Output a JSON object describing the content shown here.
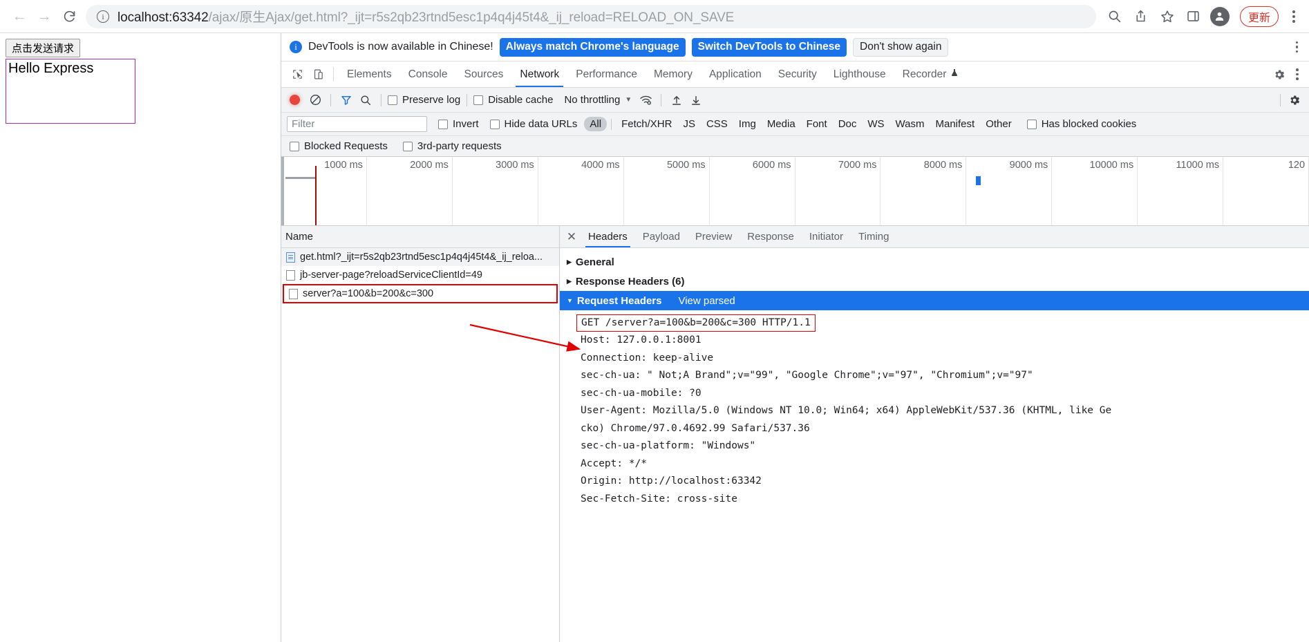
{
  "browser": {
    "back_icon": "arrow-left-icon",
    "forward_icon": "arrow-right-icon",
    "reload_icon": "reload-icon",
    "site_info_glyph": "i",
    "url_host": "localhost:63342",
    "url_path": "/ajax/原生Ajax/get.html?_ijt=r5s2qb23rtnd5esc1p4q4j45t4&_ij_reload=RELOAD_ON_SAVE",
    "update_button_label": "更新",
    "accent_red": "#d93025"
  },
  "page": {
    "send_button_label": "点击发送请求",
    "result_text": "Hello Express",
    "result_border_color": "#9b30b8"
  },
  "devtools": {
    "notice": {
      "message": "DevTools is now available in Chinese!",
      "primary_button": "Always match Chrome's language",
      "secondary_button": "Switch DevTools to Chinese",
      "dismiss_button": "Don't show again"
    },
    "tabs": [
      {
        "label": "Elements",
        "active": false
      },
      {
        "label": "Console",
        "active": false
      },
      {
        "label": "Sources",
        "active": false
      },
      {
        "label": "Network",
        "active": true
      },
      {
        "label": "Performance",
        "active": false
      },
      {
        "label": "Memory",
        "active": false
      },
      {
        "label": "Application",
        "active": false
      },
      {
        "label": "Security",
        "active": false
      },
      {
        "label": "Lighthouse",
        "active": false
      },
      {
        "label": "Recorder",
        "active": false
      }
    ],
    "network_toolbar": {
      "record_label": "record-button",
      "clear_label": "clear-button",
      "filter_label": "filter-button",
      "search_label": "search-button",
      "preserve_log": "Preserve log",
      "disable_cache": "Disable cache",
      "throttling": "No throttling",
      "import_label": "import-har-button",
      "export_label": "export-har-button"
    },
    "filter_bar": {
      "filter_placeholder": "Filter",
      "invert": "Invert",
      "hide_data_urls": "Hide data URLs",
      "types": [
        "All",
        "Fetch/XHR",
        "JS",
        "CSS",
        "Img",
        "Media",
        "Font",
        "Doc",
        "WS",
        "Wasm",
        "Manifest",
        "Other"
      ],
      "active_type": "All",
      "has_blocked_cookies": "Has blocked cookies",
      "blocked_requests": "Blocked Requests",
      "third_party_requests": "3rd-party requests"
    },
    "timeline": {
      "ticks": [
        "1000 ms",
        "2000 ms",
        "3000 ms",
        "4000 ms",
        "5000 ms",
        "6000 ms",
        "7000 ms",
        "8000 ms",
        "9000 ms",
        "10000 ms",
        "11000 ms",
        "120"
      ]
    },
    "request_list": {
      "column_header": "Name",
      "rows": [
        {
          "name": "get.html?_ijt=r5s2qb23rtnd5esc1p4q4j45t4&_ij_reloa...",
          "icon": "document-icon",
          "selected": true,
          "highlighted": false
        },
        {
          "name": "jb-server-page?reloadServiceClientId=49",
          "icon": "blank-document-icon",
          "selected": false,
          "highlighted": false
        },
        {
          "name": "server?a=100&b=200&c=300",
          "icon": "blank-document-icon",
          "selected": false,
          "highlighted": true
        }
      ]
    },
    "details": {
      "tabs": [
        {
          "label": "Headers",
          "active": true
        },
        {
          "label": "Payload",
          "active": false
        },
        {
          "label": "Preview",
          "active": false
        },
        {
          "label": "Response",
          "active": false
        },
        {
          "label": "Initiator",
          "active": false
        },
        {
          "label": "Timing",
          "active": false
        }
      ],
      "sections": [
        {
          "title": "General",
          "expanded": false
        },
        {
          "title": "Response Headers (6)",
          "expanded": false
        },
        {
          "title": "Request Headers",
          "expanded": true,
          "action": "View parsed"
        }
      ],
      "request_header_lines": [
        {
          "text": "GET /server?a=100&b=200&c=300 HTTP/1.1",
          "boxed": true
        },
        {
          "text": "Host: 127.0.0.1:8001",
          "boxed": false
        },
        {
          "text": "Connection: keep-alive",
          "boxed": false
        },
        {
          "text": "sec-ch-ua: \" Not;A Brand\";v=\"99\", \"Google Chrome\";v=\"97\", \"Chromium\";v=\"97\"",
          "boxed": false
        },
        {
          "text": "sec-ch-ua-mobile: ?0",
          "boxed": false
        },
        {
          "text": "User-Agent: Mozilla/5.0 (Windows NT 10.0; Win64; x64) AppleWebKit/537.36 (KHTML, like Ge",
          "boxed": false
        },
        {
          "text": "cko) Chrome/97.0.4692.99 Safari/537.36",
          "boxed": false
        },
        {
          "text": "sec-ch-ua-platform: \"Windows\"",
          "boxed": false
        },
        {
          "text": "Accept: */*",
          "boxed": false
        },
        {
          "text": "Origin: http://localhost:63342",
          "boxed": false
        },
        {
          "text": "Sec-Fetch-Site: cross-site",
          "boxed": false
        }
      ]
    }
  },
  "annotation": {
    "color": "#e00000"
  }
}
